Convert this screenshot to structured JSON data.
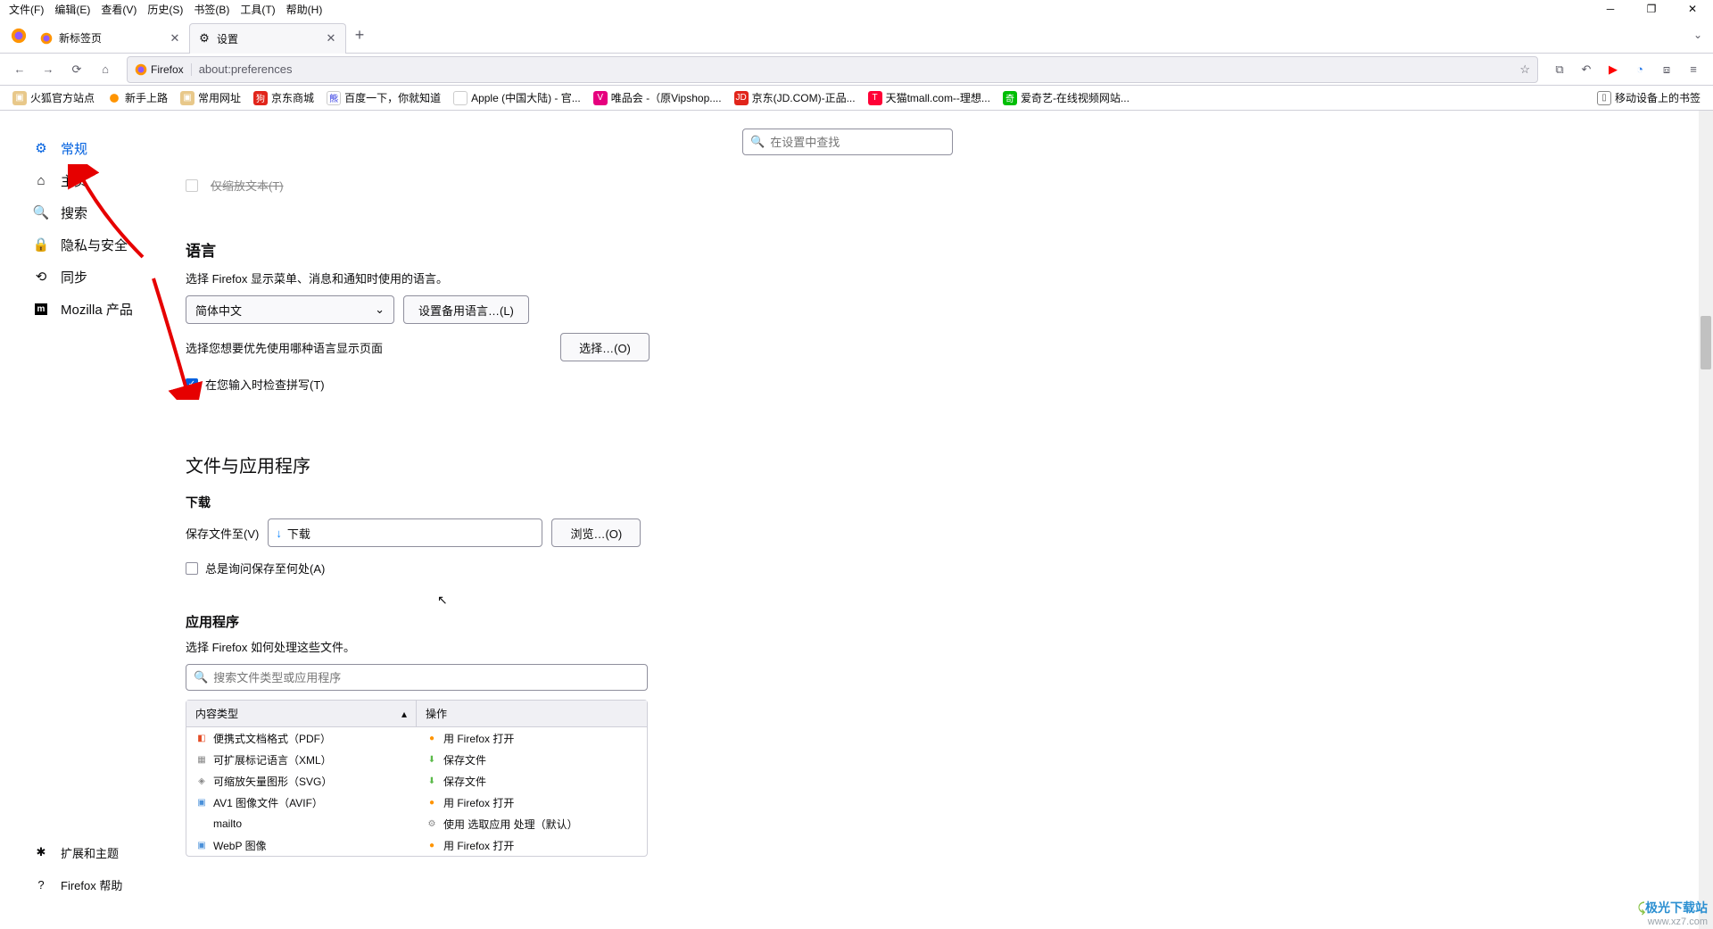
{
  "menubar": [
    "文件(F)",
    "编辑(E)",
    "查看(V)",
    "历史(S)",
    "书签(B)",
    "工具(T)",
    "帮助(H)"
  ],
  "tabs": [
    {
      "label": "新标签页",
      "active": false
    },
    {
      "label": "设置",
      "active": true
    }
  ],
  "addressbar": {
    "identity": "Firefox",
    "url": "about:preferences"
  },
  "bookmarks": [
    {
      "label": "火狐官方站点",
      "icon": "folder",
      "color": "#b89b72"
    },
    {
      "label": "新手上路",
      "icon": "ff",
      "color": "#ff9400"
    },
    {
      "label": "常用网址",
      "icon": "folder",
      "color": "#b89b72"
    },
    {
      "label": "京东商城",
      "icon": "jd",
      "color": "#e1251b"
    },
    {
      "label": "百度一下，你就知道",
      "icon": "baidu",
      "color": "#2932e1"
    },
    {
      "label": "Apple (中国大陆) - 官...",
      "icon": "apple",
      "color": "#000"
    },
    {
      "label": "唯品会 -（原Vipshop....",
      "icon": "vip",
      "color": "#e6007e"
    },
    {
      "label": "京东(JD.COM)-正品...",
      "icon": "jd",
      "color": "#e1251b"
    },
    {
      "label": "天猫tmall.com--理想...",
      "icon": "tmall",
      "color": "#ff0036"
    },
    {
      "label": "爱奇艺-在线视频网站...",
      "icon": "iqy",
      "color": "#00be06"
    }
  ],
  "bookmark_mobile": "移动设备上的书签",
  "sidebar": {
    "items": [
      {
        "label": "常规",
        "icon": "gear",
        "active": true
      },
      {
        "label": "主页",
        "icon": "home"
      },
      {
        "label": "搜索",
        "icon": "search"
      },
      {
        "label": "隐私与安全",
        "icon": "lock"
      },
      {
        "label": "同步",
        "icon": "sync"
      },
      {
        "label": "Mozilla 产品",
        "icon": "mozilla"
      }
    ],
    "footer": [
      {
        "label": "扩展和主题",
        "icon": "puzzle"
      },
      {
        "label": "Firefox 帮助",
        "icon": "help"
      }
    ]
  },
  "search_placeholder": "在设置中查找",
  "cutoff_text": "仅缩放文本(T)",
  "language": {
    "title": "语言",
    "desc": "选择 Firefox 显示菜单、消息和通知时使用的语言。",
    "selected": "简体中文",
    "alt_btn": "设置备用语言…(L)",
    "prefer_desc": "选择您想要优先使用哪种语言显示页面",
    "choose_btn": "选择…(O)",
    "spellcheck": "在您输入时检查拼写(T)"
  },
  "files": {
    "title": "文件与应用程序",
    "download": "下载",
    "save_to": "保存文件至(V)",
    "path": "下载",
    "browse": "浏览…(O)",
    "always_ask": "总是询问保存至何处(A)"
  },
  "apps": {
    "title": "应用程序",
    "desc": "选择 Firefox 如何处理这些文件。",
    "search_placeholder": "搜索文件类型或应用程序",
    "col_type": "内容类型",
    "col_action": "操作",
    "rows": [
      {
        "type": "便携式文档格式（PDF）",
        "action": "用 Firefox 打开",
        "ticon": "pdf",
        "aicon": "ff"
      },
      {
        "type": "可扩展标记语言（XML）",
        "action": "保存文件",
        "ticon": "xml",
        "aicon": "save"
      },
      {
        "type": "可缩放矢量图形（SVG）",
        "action": "保存文件",
        "ticon": "svg",
        "aicon": "save"
      },
      {
        "type": "AV1 图像文件（AVIF）",
        "action": "用 Firefox 打开",
        "ticon": "img",
        "aicon": "ff"
      },
      {
        "type": "mailto",
        "action": "使用 选取应用 处理（默认）",
        "ticon": "blank",
        "aicon": "app"
      },
      {
        "type": "WebP 图像",
        "action": "用 Firefox 打开",
        "ticon": "img",
        "aicon": "ff"
      }
    ]
  },
  "watermark": {
    "line1": "极光下载站",
    "line2": "www.xz7.com"
  }
}
